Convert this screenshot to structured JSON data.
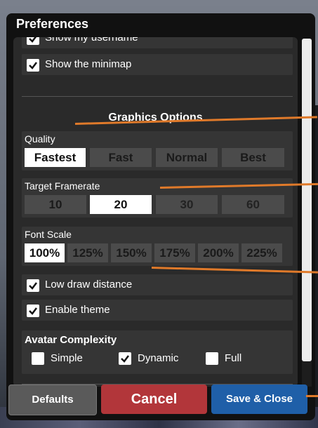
{
  "dialog": {
    "title": "Preferences"
  },
  "toggles_top": [
    {
      "label": "Show my username",
      "checked": true
    },
    {
      "label": "Show the minimap",
      "checked": true
    }
  ],
  "graphics": {
    "section_title": "Graphics Options",
    "quality": {
      "label": "Quality",
      "options": [
        "Fastest",
        "Fast",
        "Normal",
        "Best"
      ],
      "selected": "Fastest"
    },
    "framerate": {
      "label": "Target Framerate",
      "options": [
        "10",
        "20",
        "30",
        "60"
      ],
      "selected": "20"
    },
    "font_scale": {
      "label": "Font Scale",
      "options": [
        "100%",
        "125%",
        "150%",
        "175%",
        "200%",
        "225%"
      ],
      "selected": "100%"
    }
  },
  "toggles_bottom": [
    {
      "label": "Low draw distance",
      "checked": true
    },
    {
      "label": "Enable theme",
      "checked": true
    }
  ],
  "avatar": {
    "label": "Avatar Complexity",
    "options": [
      {
        "label": "Simple",
        "checked": false
      },
      {
        "label": "Dynamic",
        "checked": true
      },
      {
        "label": "Full",
        "checked": false
      }
    ]
  },
  "buttons": {
    "defaults": "Defaults",
    "cancel": "Cancel",
    "save": "Save & Close"
  },
  "colors": {
    "accent_orange": "#e07a2a",
    "cancel_red": "#b2363a",
    "save_blue": "#1f5fa8"
  }
}
